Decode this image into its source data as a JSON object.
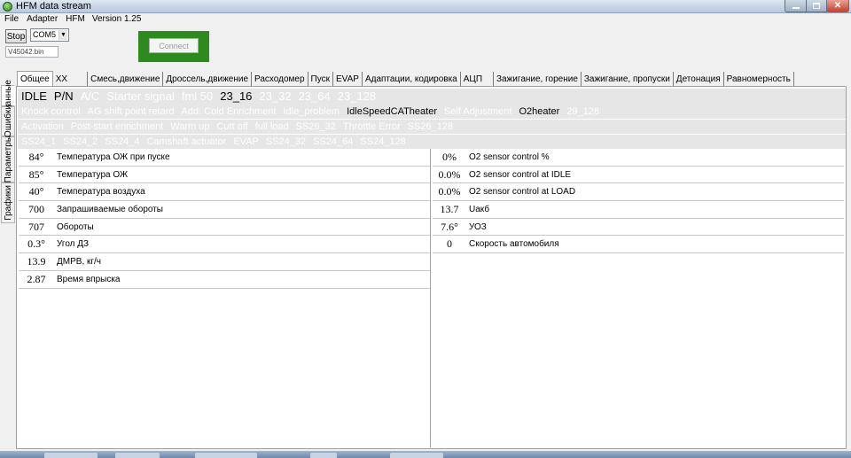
{
  "window": {
    "title": "HFM data stream"
  },
  "menu": {
    "items": [
      "File",
      "Adapter",
      "HFM"
    ],
    "version": "Version 1.25"
  },
  "toolbar": {
    "stop_label": "Stop",
    "port_value": "COM5",
    "file_value": "V45042.bin",
    "connect_label": "Connect"
  },
  "side_tabs": [
    "Данные",
    "Ошибки",
    "Параметры",
    "Графики"
  ],
  "tabs": [
    "Общее",
    "XX",
    "Смесь,движение",
    "Дроссель,движение",
    "Расходомер",
    "Пуск",
    "EVAP",
    "Адаптации, кодировка",
    "АЦП",
    "Зажигание, горение",
    "Зажигание, пропуски",
    "Детонация",
    "Равномерность"
  ],
  "status": {
    "row1": [
      {
        "text": "IDLE",
        "on": true
      },
      {
        "text": "P/N",
        "on": true
      },
      {
        "text": "A/C",
        "on": false
      },
      {
        "text": "Starter signal",
        "on": false
      },
      {
        "text": "fml 50",
        "on": false
      },
      {
        "text": "23_16",
        "on": true
      },
      {
        "text": "23_32",
        "on": false
      },
      {
        "text": "23_64",
        "on": false
      },
      {
        "text": "23_128",
        "on": false
      }
    ],
    "row2": [
      {
        "text": "Knock control",
        "on": false
      },
      {
        "text": "AG shift point retard",
        "on": false
      },
      {
        "text": "Add. Cold Enrichment",
        "on": false
      },
      {
        "text": "Idle_problem",
        "on": false
      },
      {
        "text": "IdleSpeedCATheater",
        "on": true
      },
      {
        "text": "Self Adjustment",
        "on": false
      },
      {
        "text": "O2heater",
        "on": true
      },
      {
        "text": "29_128",
        "on": false
      }
    ],
    "row3": [
      {
        "text": "Activation",
        "on": false
      },
      {
        "text": "Post-start enrichment",
        "on": false
      },
      {
        "text": "Warm up",
        "on": false
      },
      {
        "text": "Cutt off",
        "on": false
      },
      {
        "text": "full load",
        "on": false
      },
      {
        "text": "SS26_32",
        "on": false
      },
      {
        "text": "Throttle Error",
        "on": false
      },
      {
        "text": "SS26_128",
        "on": false
      }
    ],
    "row4": [
      {
        "text": "SS24_1",
        "on": false
      },
      {
        "text": "SS24_2",
        "on": false
      },
      {
        "text": "SS24_4",
        "on": false
      },
      {
        "text": "Camshaft actuator",
        "on": false
      },
      {
        "text": "EVAP",
        "on": false
      },
      {
        "text": "SS24_32",
        "on": false
      },
      {
        "text": "SS24_64",
        "on": false
      },
      {
        "text": "SS24_128",
        "on": false
      }
    ]
  },
  "left_params": [
    {
      "value": "84°",
      "label": "Температура ОЖ при пуске"
    },
    {
      "value": "85°",
      "label": "Температура ОЖ"
    },
    {
      "value": "40°",
      "label": "Температура воздуха"
    },
    {
      "value": "700",
      "label": "Запрашиваемые обороты"
    },
    {
      "value": "707",
      "label": "Обороты"
    },
    {
      "value": "0.3°",
      "label": "Угол ДЗ"
    },
    {
      "value": "13.9",
      "label": "ДМРВ, кг/ч"
    },
    {
      "value": "2.87",
      "label": "Время впрыска"
    }
  ],
  "right_params": [
    {
      "value": "0%",
      "label": "O2 sensor control %"
    },
    {
      "value": "0.0%",
      "label": "O2 sensor control at IDLE"
    },
    {
      "value": "0.0%",
      "label": "O2 sensor control at LOAD"
    },
    {
      "value": "13.7",
      "label": "Uакб"
    },
    {
      "value": "7.6°",
      "label": "УОЗ"
    },
    {
      "value": "0",
      "label": "Скорость автомобиля"
    }
  ]
}
